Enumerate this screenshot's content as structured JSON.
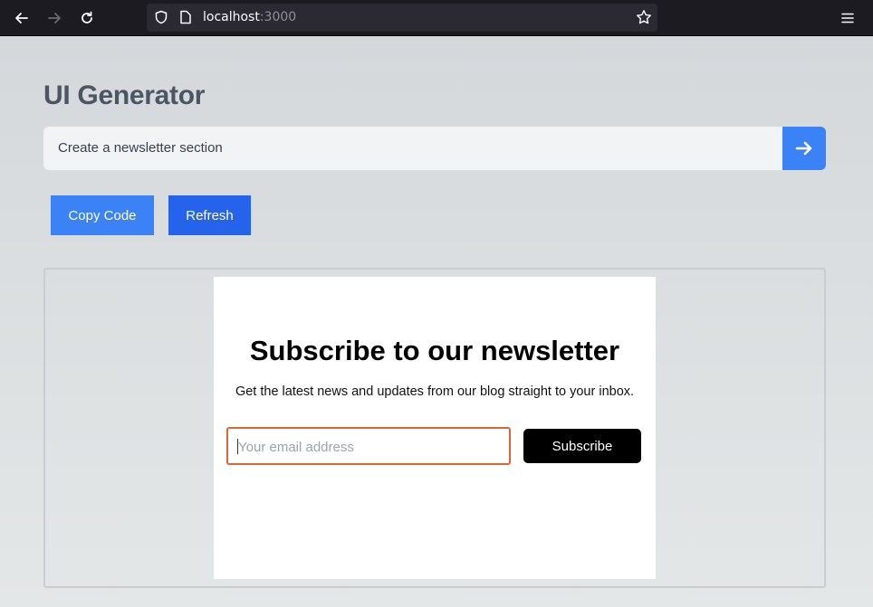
{
  "browser": {
    "url_host": "localhost",
    "url_port": ":3000",
    "icons": [
      "back-arrow-icon",
      "forward-arrow-icon",
      "reload-icon",
      "shield-icon",
      "page-icon",
      "bookmark-star-icon",
      "hamburger-menu-icon"
    ]
  },
  "app": {
    "title": "UI Generator",
    "prompt_value": "Create a newsletter section",
    "submit_icon": "arrow-right-icon",
    "copy_label": "Copy Code",
    "refresh_label": "Refresh"
  },
  "preview": {
    "heading": "Subscribe to our newsletter",
    "subheading": "Get the latest news and updates from our blog straight to your inbox.",
    "email_placeholder": "Your email address",
    "subscribe_label": "Subscribe"
  },
  "colors": {
    "accent": "#3b82f6",
    "accent_dark": "#2563eb",
    "focus_border": "#e0652e",
    "title_gray": "#4b5563"
  }
}
